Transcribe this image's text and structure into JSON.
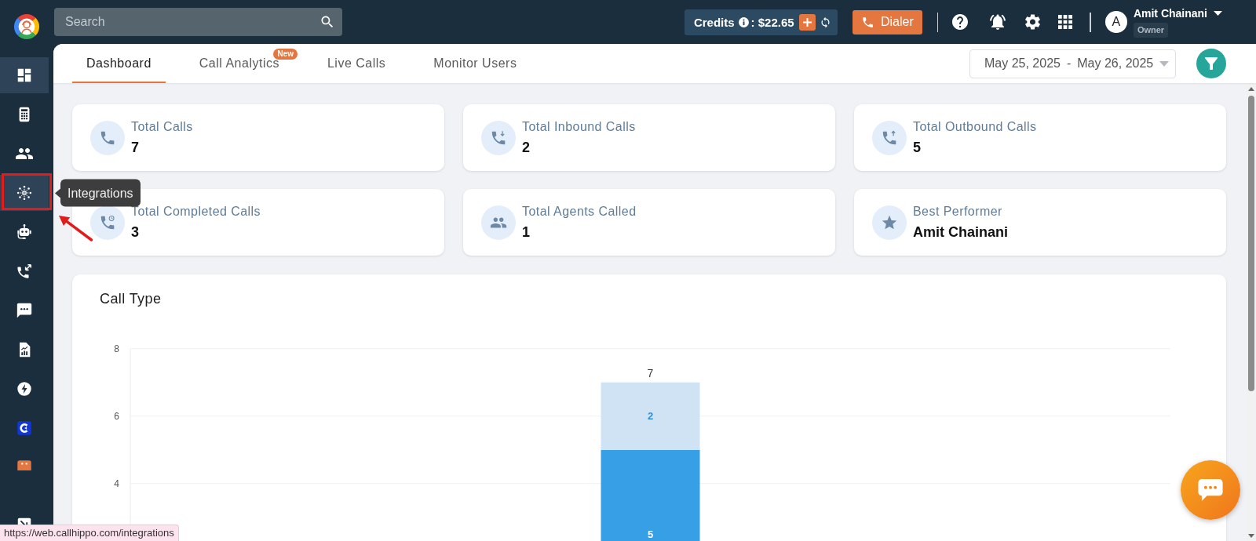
{
  "sidebar": {
    "items": [
      {
        "selected": true,
        "hovered": false,
        "highlighted": false
      },
      {
        "selected": false,
        "hovered": false,
        "highlighted": false
      },
      {
        "selected": false,
        "hovered": false,
        "highlighted": false
      },
      {
        "selected": false,
        "hovered": true,
        "highlighted": true,
        "tooltip": "Integrations"
      },
      {
        "selected": false,
        "hovered": false,
        "highlighted": false
      },
      {
        "selected": false,
        "hovered": false,
        "highlighted": false
      },
      {
        "selected": false,
        "hovered": false,
        "highlighted": false
      },
      {
        "selected": false,
        "hovered": false,
        "highlighted": false
      },
      {
        "selected": false,
        "hovered": false,
        "highlighted": false
      },
      {
        "selected": false,
        "hovered": false,
        "highlighted": false
      },
      {
        "selected": false,
        "hovered": false,
        "highlighted": false
      }
    ],
    "bottom_items": [
      {
        "selected": false,
        "hovered": false,
        "highlighted": false
      }
    ]
  },
  "topbar": {
    "search": {
      "placeholder": "Search"
    },
    "credits": {
      "label": "Credits",
      "amount": ": $22.65"
    },
    "dialer": {
      "label": "Dialer"
    },
    "user": {
      "initial": "A",
      "name": "Amit Chainani",
      "role": "Owner"
    }
  },
  "tabs": [
    {
      "label": "Dashboard",
      "selected": true
    },
    {
      "label": "Call Analytics",
      "selected": false,
      "badge": "New"
    },
    {
      "label": "Live Calls",
      "selected": false
    },
    {
      "label": "Monitor Users",
      "selected": false
    }
  ],
  "date_range": {
    "start": "May 25, 2025",
    "separator": "-",
    "end": "May 26, 2025"
  },
  "stats": [
    {
      "label": "Total Calls",
      "value": "7"
    },
    {
      "label": "Total Inbound Calls",
      "value": "2"
    },
    {
      "label": "Total Outbound Calls",
      "value": "5"
    },
    {
      "label": "Total Completed Calls",
      "value": "3"
    },
    {
      "label": "Total Agents Called",
      "value": "1"
    },
    {
      "label": "Best Performer",
      "value": "Amit Chainani"
    }
  ],
  "call_type": {
    "title": "Call Type",
    "chart_data": {
      "type": "bar",
      "stacked": true,
      "ylim": [
        0,
        8
      ],
      "yticks": [
        4,
        6,
        8
      ],
      "series": [
        {
          "color": "#379fe6",
          "values": [
            5
          ]
        },
        {
          "color": "#cfe3f5",
          "values": [
            2
          ]
        }
      ],
      "data_labels": true,
      "annotations": [
        {
          "text": "7",
          "y": 7
        }
      ]
    }
  },
  "status_bar": {
    "url": "https://web.callhippo.com/integrations"
  }
}
